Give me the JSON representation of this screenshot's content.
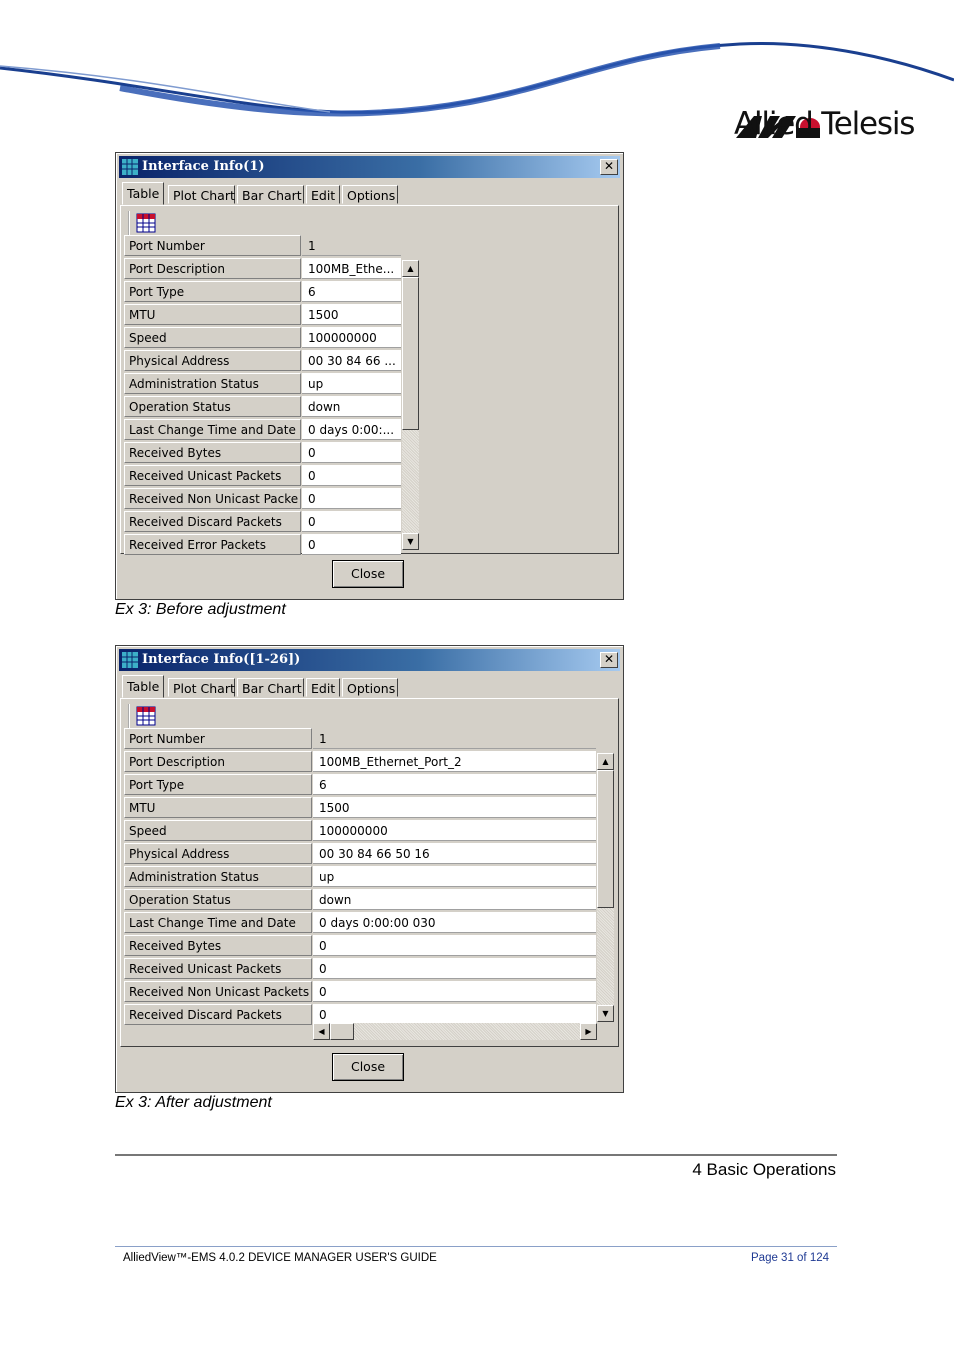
{
  "brand": {
    "logo_icon": "allied-telesis-logo-mark",
    "name": "Allied Telesis"
  },
  "windows": [
    {
      "title": "Interface Info(1)",
      "tabs": [
        "Table",
        "Plot Chart",
        "Bar Chart",
        "Edit",
        "Options"
      ],
      "active_tab": "Table",
      "rows": [
        {
          "label": "Port Number",
          "value": "1"
        },
        {
          "label": "Port Description",
          "value": "100MB_Ethe..."
        },
        {
          "label": "Port Type",
          "value": "6"
        },
        {
          "label": "MTU",
          "value": "1500"
        },
        {
          "label": "Speed",
          "value": "100000000"
        },
        {
          "label": "Physical Address",
          "value": "00 30 84 66 ..."
        },
        {
          "label": "Administration Status",
          "value": "up"
        },
        {
          "label": "Operation Status",
          "value": "down"
        },
        {
          "label": "Last Change Time and Date",
          "value": "0 days 0:00:..."
        },
        {
          "label": "Received Bytes",
          "value": "0"
        },
        {
          "label": "Received Unicast Packets",
          "value": "0"
        },
        {
          "label": "Received Non Unicast Packe",
          "value": "0"
        },
        {
          "label": "Received Discard Packets",
          "value": "0"
        },
        {
          "label": "Received Error Packets",
          "value": "0"
        }
      ],
      "close_label": "Close"
    },
    {
      "title": "Interface Info([1-26])",
      "tabs": [
        "Table",
        "Plot Chart",
        "Bar Chart",
        "Edit",
        "Options"
      ],
      "active_tab": "Table",
      "rows": [
        {
          "label": "Port Number",
          "value": "1"
        },
        {
          "label": "Port Description",
          "value": "100MB_Ethernet_Port_2"
        },
        {
          "label": "Port Type",
          "value": "6"
        },
        {
          "label": "MTU",
          "value": "1500"
        },
        {
          "label": "Speed",
          "value": "100000000"
        },
        {
          "label": "Physical Address",
          "value": "00 30 84 66 50 16"
        },
        {
          "label": "Administration Status",
          "value": "up"
        },
        {
          "label": "Operation Status",
          "value": "down"
        },
        {
          "label": "Last Change Time and Date",
          "value": "0 days 0:00:00 030"
        },
        {
          "label": "Received Bytes",
          "value": "0"
        },
        {
          "label": "Received Unicast Packets",
          "value": "0"
        },
        {
          "label": "Received Non Unicast Packets",
          "value": "0"
        },
        {
          "label": "Received Discard Packets",
          "value": "0"
        }
      ],
      "close_label": "Close"
    }
  ],
  "captions": {
    "before": "Ex 3: Before adjustment",
    "after": "Ex 3: After adjustment"
  },
  "section_title": "4 Basic Operations",
  "footer": {
    "doc_title": "AlliedView™-EMS 4.0.2  DEVICE MANAGER USER'S GUIDE",
    "page": "Page 31 of 124"
  }
}
